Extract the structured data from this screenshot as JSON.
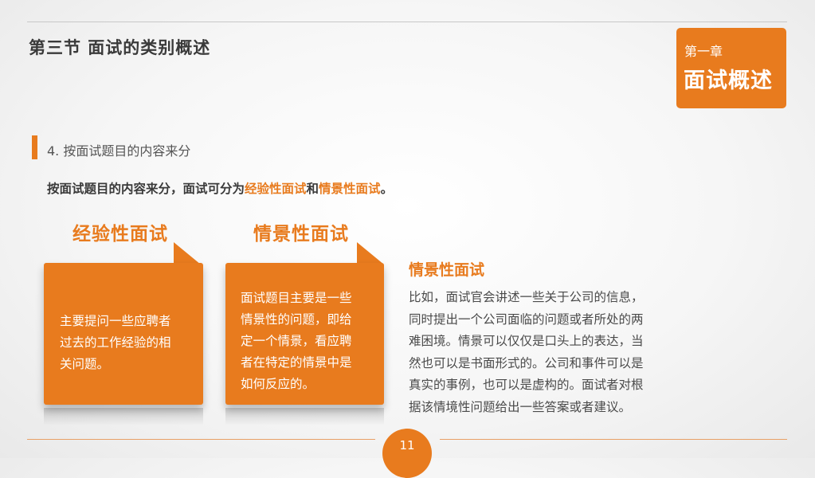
{
  "header": {
    "title": "第三节  面试的类别概述",
    "chapter_small": "第一章",
    "chapter_big": "面试概述"
  },
  "section": {
    "title": "4. 按面试题目的内容来分"
  },
  "lead": {
    "prefix": "按面试题目的内容来分，面试可分为",
    "highlight1": "经验性面试",
    "middle": "和",
    "highlight2": "情景性面试",
    "suffix": "。"
  },
  "cards": [
    {
      "heading": "经验性面试",
      "lines": [
        "主要提问一些应聘者",
        "过去的工作经验的相",
        "关问题。"
      ]
    },
    {
      "heading": "情景性面试",
      "lines": [
        "面试题目主要是一些",
        "情景性的问题，即给",
        "定一个情景，看应聘",
        "者在特定的情景中是",
        "如何反应的。"
      ]
    }
  ],
  "detail": {
    "title": "情景性面试",
    "lines": [
      "比如，面试官会讲述一些关于公司的信息，",
      "同时提出一个公司面临的问题或者所处的两",
      "难困境。情景可以仅仅是口头上的表达，当",
      "然也可以是书面形式的。公司和事件可以是",
      "真实的事例，也可以是虚构的。面试者对根",
      "据该情境性问题给出一些答案或者建议。"
    ]
  },
  "page_number": "11",
  "colors": {
    "accent": "#e87b1e"
  }
}
